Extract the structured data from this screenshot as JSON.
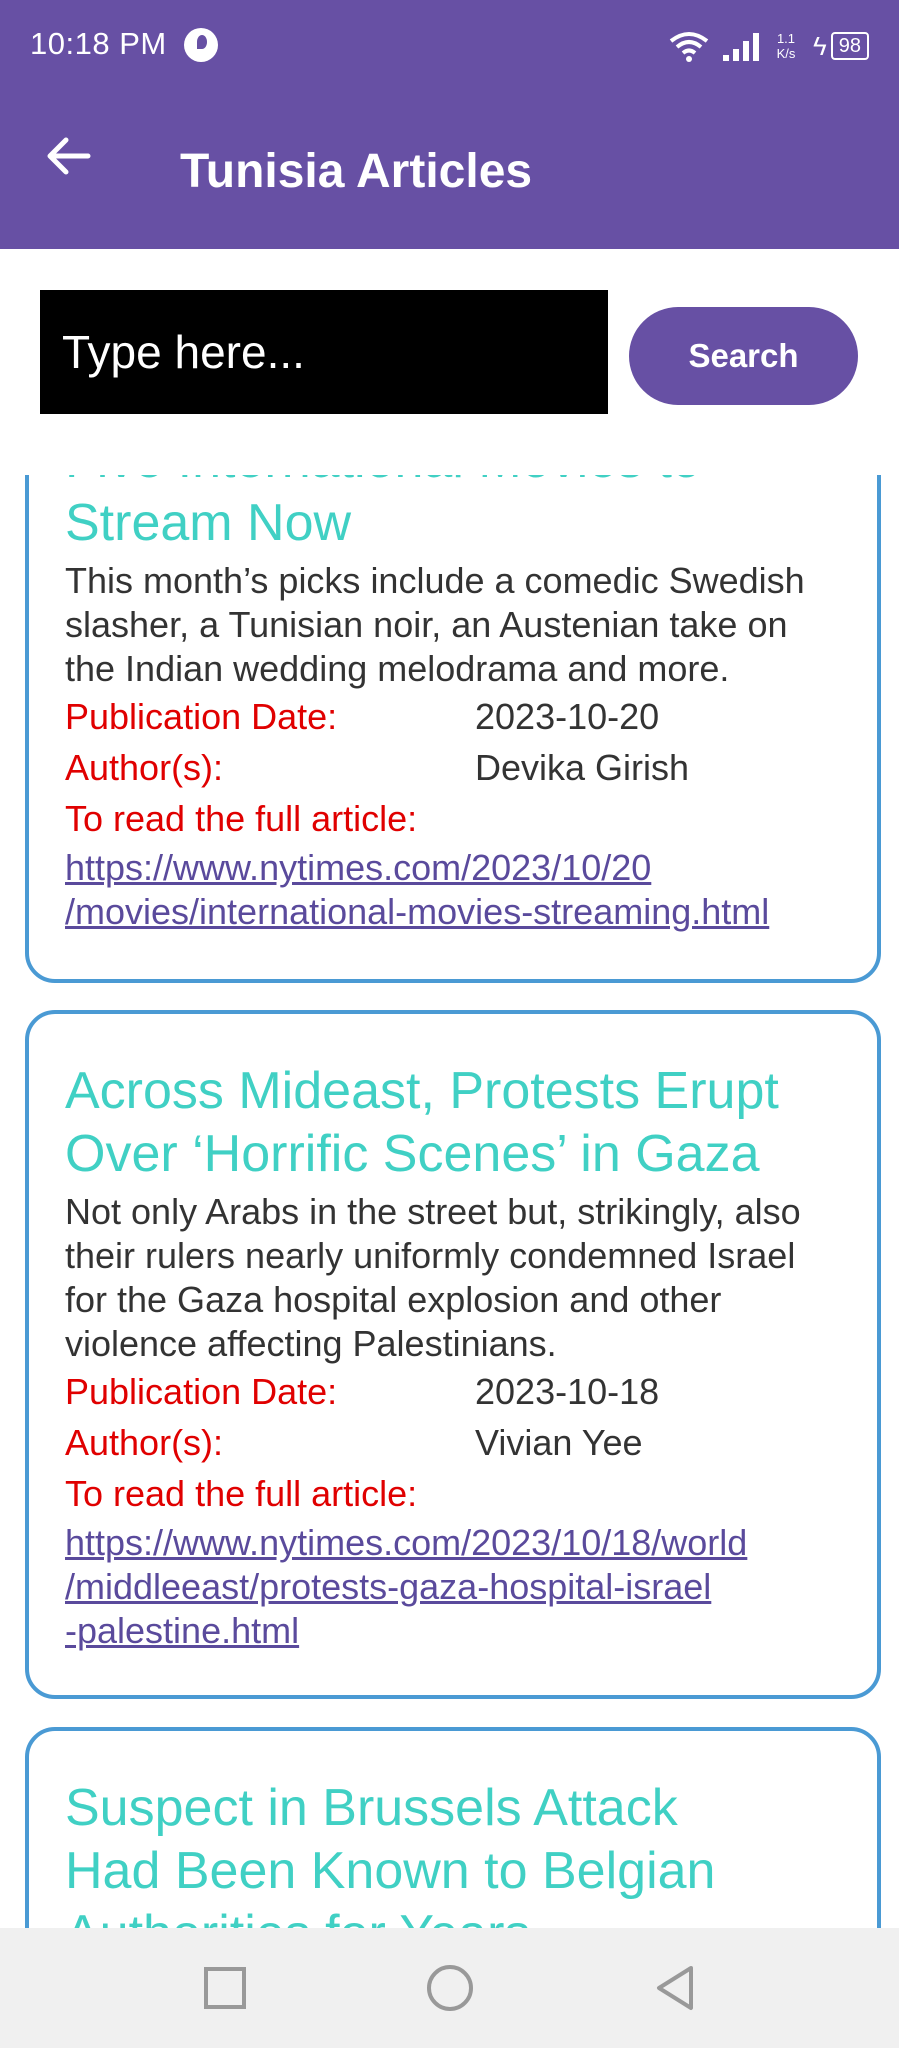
{
  "status_bar": {
    "time": "10:18 PM",
    "speed_top": "1.1",
    "speed_bottom": "K/s",
    "battery": "98"
  },
  "app_bar": {
    "title": "Tunisia Articles"
  },
  "search": {
    "placeholder": "Type here...",
    "button_label": "Search"
  },
  "labels": {
    "publication_date": "Publication Date:",
    "authors": "Author(s):",
    "read_full": "To read the full article:"
  },
  "articles": [
    {
      "title_hidden": "Five International Movies to",
      "title_visible": "Stream Now",
      "description": "This month’s picks include a comedic Swedish slasher, a Tunisian noir, an Austenian take on the Indian wedding melodrama and more.",
      "date": "2023-10-20",
      "authors": "Devika Girish",
      "link_line1": "https://www.nytimes.com/2023/10/20",
      "link_line2": "/movies/international-movies-streaming.html"
    },
    {
      "title_line1": "Across Mideast, Protests Erupt",
      "title_line2": "Over ‘Horrific Scenes’ in Gaza",
      "description": "Not only Arabs in the street but, strikingly, also their rulers nearly uniformly condemned Israel for the Gaza hospital explosion and other violence affecting Palestinians.",
      "date": "2023-10-18",
      "authors": "Vivian Yee",
      "link_line1": "https://www.nytimes.com/2023/10/18/world",
      "link_line2": "/middleeast/protests-gaza-hospital-israel",
      "link_line3": "-palestine.html"
    },
    {
      "title_line1": "Suspect in Brussels Attack",
      "title_line2": "Had Been Known to Belgian",
      "title_line3": "Authorities for Years"
    }
  ],
  "colors": {
    "primary": "#6750A4",
    "title": "#40D0C4",
    "label_red": "#E00000",
    "card_border": "#4A9AD4",
    "link": "#5A4A9C"
  }
}
